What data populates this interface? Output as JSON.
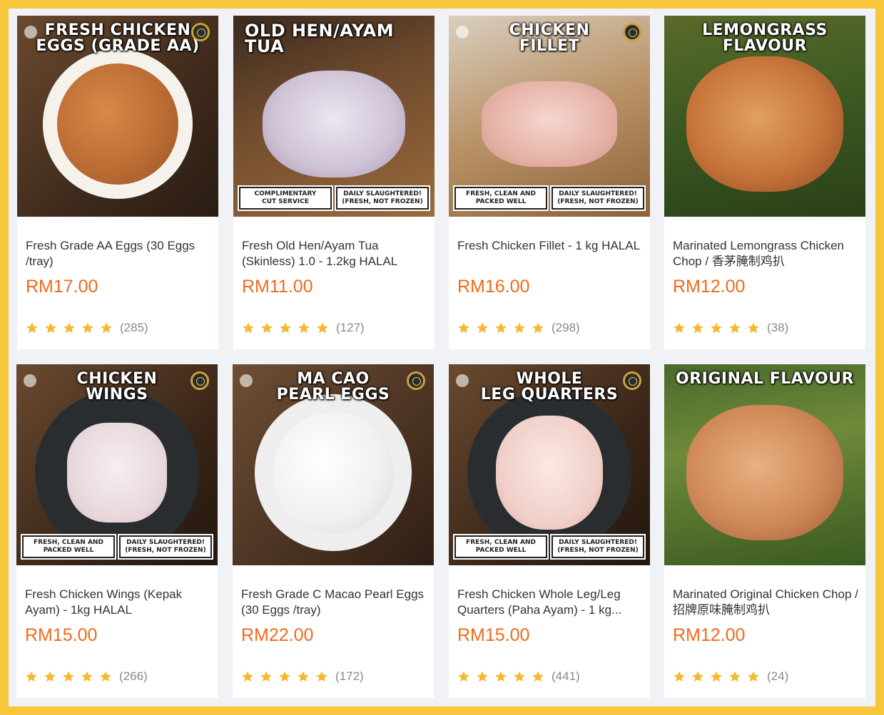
{
  "products": [
    {
      "overlay": "FRESH CHICKEN\nEGGS (GRADE AA)",
      "name": "Fresh Grade AA Eggs (30 Eggs /tray)",
      "price": "RM17.00",
      "count": "(285)",
      "tags": []
    },
    {
      "overlay": "OLD HEN/AYAM TUA",
      "name": "Fresh Old Hen/Ayam Tua (Skinless) 1.0 - 1.2kg HALAL",
      "price": "RM11.00",
      "count": "(127)",
      "tags": [
        "COMPLIMENTARY\nCUT SERVICE",
        "DAILY SLAUGHTERED!\n(FRESH, NOT FROZEN)"
      ]
    },
    {
      "overlay": "CHICKEN\nFILLET",
      "name": "Fresh Chicken Fillet - 1 kg HALAL",
      "price": "RM16.00",
      "count": "(298)",
      "tags": [
        "FRESH, CLEAN AND\nPACKED WELL",
        "DAILY SLAUGHTERED!\n(FRESH, NOT FROZEN)"
      ]
    },
    {
      "overlay": "LEMONGRASS FLAVOUR",
      "name": "Marinated Lemongrass Chicken Chop / 香茅腌制鸡扒",
      "price": "RM12.00",
      "count": "(38)",
      "tags": []
    },
    {
      "overlay": "CHICKEN\nWINGS",
      "name": "Fresh Chicken Wings (Kepak Ayam) - 1kg HALAL",
      "price": "RM15.00",
      "count": "(266)",
      "tags": [
        "FRESH, CLEAN AND\nPACKED WELL",
        "DAILY SLAUGHTERED!\n(FRESH, NOT FROZEN)"
      ]
    },
    {
      "overlay": "MA CAO\nPEARL EGGS",
      "name": "Fresh Grade C Macao Pearl Eggs (30 Eggs /tray)",
      "price": "RM22.00",
      "count": "(172)",
      "tags": []
    },
    {
      "overlay": "WHOLE\nLEG QUARTERS",
      "name": "Fresh Chicken Whole Leg/Leg Quarters (Paha Ayam) - 1 kg...",
      "price": "RM15.00",
      "count": "(441)",
      "tags": [
        "FRESH, CLEAN AND\nPACKED WELL",
        "DAILY SLAUGHTERED!\n(FRESH, NOT FROZEN)"
      ]
    },
    {
      "overlay": "ORIGINAL FLAVOUR",
      "name": "Marinated Original Chicken Chop / 招牌原味腌制鸡扒",
      "price": "RM12.00",
      "count": "(24)",
      "tags": []
    }
  ],
  "rating_stars": 5,
  "colors": {
    "price": "#f26a1b",
    "star": "#f5b82e",
    "border": "#f7c63b"
  }
}
